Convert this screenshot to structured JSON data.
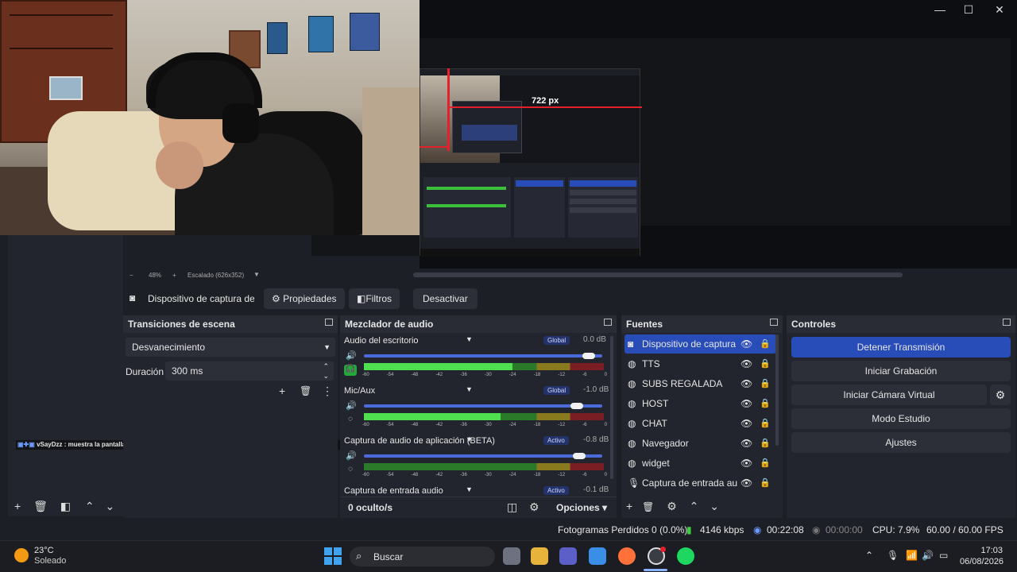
{
  "window": {
    "minimize": "—",
    "maximize": "☐",
    "close": "✕"
  },
  "preview": {
    "measure_label": "722 px"
  },
  "zoom": {
    "minus": "−",
    "value": "48%",
    "plus": "+",
    "scale": "Escalado (626x352)"
  },
  "source_toolbar": {
    "source_name": "Dispositivo de captura de v",
    "properties": "Propiedades",
    "filters": "Filtros",
    "deactivate": "Desactivar"
  },
  "transitions": {
    "title": "Transiciones de escena",
    "selected": "Desvanecimiento",
    "duration_label": "Duración",
    "duration_value": "300 ms"
  },
  "mixer": {
    "title": "Mezclador de audio",
    "ticks": [
      "-60",
      "-54",
      "-48",
      "-42",
      "-36",
      "-30",
      "-24",
      "-18",
      "-12",
      "-6",
      "0"
    ],
    "channels": [
      {
        "name": "Audio del escritorio",
        "badge": "Global",
        "db": "0.0 dB",
        "level": 0.62,
        "volume": 0.97
      },
      {
        "name": "Mic/Aux",
        "badge": "Global",
        "db": "-1.0 dB",
        "level": 0.57,
        "volume": 0.92
      },
      {
        "name": "Captura de audio de aplicación (BETA)",
        "badge": "Activo",
        "db": "-0.8 dB",
        "level": 0.0,
        "volume": 0.93
      },
      {
        "name": "Captura de entrada audio",
        "badge": "Activo",
        "db": "-0.1 dB",
        "level": 0.0,
        "volume": 0.99
      }
    ],
    "hidden": "0 oculto/s",
    "options": "Opciones"
  },
  "sources": {
    "title": "Fuentes",
    "items": [
      {
        "name": "Dispositivo de captura d",
        "icon": "camera-icon"
      },
      {
        "name": "TTS",
        "icon": "globe-icon"
      },
      {
        "name": "SUBS REGALADA",
        "icon": "globe-icon"
      },
      {
        "name": "HOST",
        "icon": "globe-icon"
      },
      {
        "name": "CHAT",
        "icon": "globe-icon"
      },
      {
        "name": "Navegador",
        "icon": "globe-icon"
      },
      {
        "name": "widget",
        "icon": "globe-icon"
      },
      {
        "name": "Captura de entrada auc",
        "icon": "microphone-icon"
      }
    ]
  },
  "controls": {
    "title": "Controles",
    "stop_stream": "Detener Transmisión",
    "start_record": "Iniciar Grabación",
    "start_virtualcam": "Iniciar Cámara Virtual",
    "studio_mode": "Modo Estudio",
    "settings": "Ajustes"
  },
  "chat_overlay": {
    "user": "vSayDzz",
    "message": ": muestra la pantalla o algo"
  },
  "status": {
    "dropped": "Fotogramas Perdidos 0 (0.0%)",
    "bitrate": "4146 kbps",
    "stream_time": "00:22:08",
    "record_time": "00:00:00",
    "cpu": "CPU: 7.9%",
    "fps": "60.00 / 60.00 FPS"
  },
  "taskbar": {
    "weather_temp": "23°C",
    "weather_text": "Soleado",
    "search": "Buscar",
    "time": "17:03",
    "date": "06/08/2026"
  },
  "colors": {
    "accent": "#284cb8",
    "record_red": "#e5202b"
  }
}
